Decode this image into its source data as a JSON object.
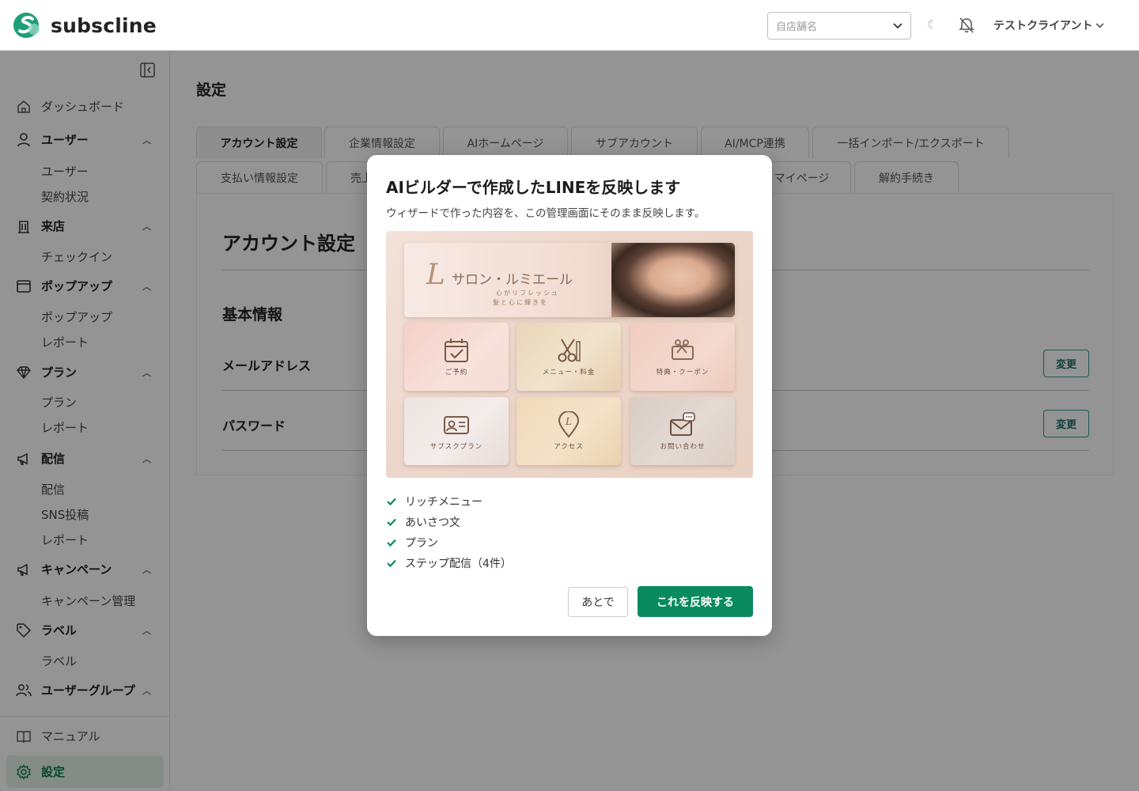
{
  "header": {
    "logo_text": "subscline",
    "store_select_placeholder": "自店舗名",
    "theme_toggle_icon": "moon-icon",
    "notification_icon": "bell-off-icon",
    "user_name": "テストクライアント"
  },
  "sidebar": {
    "items": [
      {
        "label": "ダッシュボード",
        "icon": "home-icon",
        "type": "plain"
      },
      {
        "label": "ユーザー",
        "icon": "user-icon",
        "type": "section",
        "children": [
          "ユーザー",
          "契約状況"
        ]
      },
      {
        "label": "来店",
        "icon": "building-icon",
        "type": "section",
        "children": [
          "チェックイン"
        ]
      },
      {
        "label": "ポップアップ",
        "icon": "window-icon",
        "type": "section",
        "children": [
          "ポップアップ",
          "レポート"
        ]
      },
      {
        "label": "プラン",
        "icon": "diamond-icon",
        "type": "section",
        "children": [
          "プラン",
          "レポート"
        ]
      },
      {
        "label": "配信",
        "icon": "megaphone-icon",
        "type": "section",
        "children": [
          "配信",
          "SNS投稿",
          "レポート"
        ]
      },
      {
        "label": "キャンペーン",
        "icon": "megaphone-icon",
        "type": "section",
        "children": [
          "キャンペーン管理"
        ]
      },
      {
        "label": "ラベル",
        "icon": "tag-icon",
        "type": "section",
        "children": [
          "ラベル"
        ]
      },
      {
        "label": "ユーザーグループ",
        "icon": "users-icon",
        "type": "section",
        "children": []
      }
    ],
    "footer": [
      {
        "label": "マニュアル",
        "icon": "book-icon"
      },
      {
        "label": "設定",
        "icon": "gear-icon",
        "active": true
      }
    ]
  },
  "main": {
    "page_title": "設定",
    "tabs_row1": [
      "アカウント設定",
      "企業情報設定",
      "AIホームページ",
      "サブアカウント",
      "AI/MCP連携",
      "一括インポート/エクスポート"
    ],
    "tabs_row2": [
      "支払い情報設定",
      "売上",
      "マイページ",
      "解約手続き"
    ],
    "active_tab": "アカウント設定",
    "account_title": "アカウント設定",
    "basic_info_title": "基本情報",
    "rows": [
      {
        "label": "メールアドレス",
        "button": "変更"
      },
      {
        "label": "パスワード",
        "button": "変更"
      }
    ]
  },
  "modal": {
    "title": "AIビルダーで作成したLINEを反映します",
    "description": "ウィザードで作った内容を、この管理画面にそのまま反映します。",
    "preview": {
      "shop_initial": "L",
      "shop_name": "サロン・ルミエール",
      "tagline_1": "心がリフレッシュ",
      "tagline_2": "髪と心に輝きを",
      "tiles": [
        "ご予約",
        "メニュー・料金",
        "特典・クーポン",
        "サブスクプラン",
        "アクセス",
        "お問い合わせ"
      ]
    },
    "checklist": [
      "リッチメニュー",
      "あいさつ文",
      "プラン",
      "ステップ配信（4件）"
    ],
    "later_button": "あとで",
    "apply_button": "これを反映する"
  },
  "colors": {
    "brand_green": "#0a8a5f",
    "active_nav_bg": "#e3f2ea",
    "overlay": "rgba(0,0,0,0.42)"
  }
}
